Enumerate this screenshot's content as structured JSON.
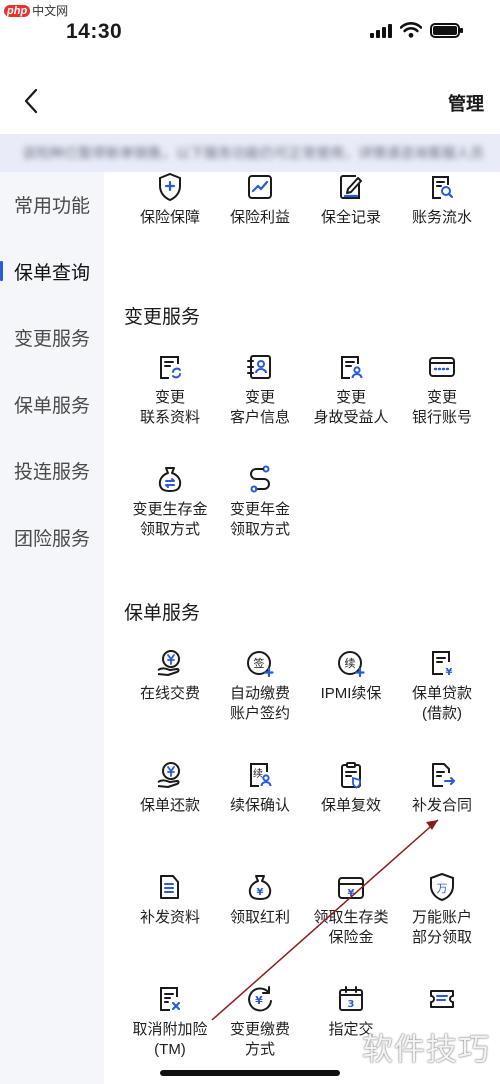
{
  "watermark_top": {
    "logo": "php",
    "site": "中文网"
  },
  "status": {
    "time": "14:30"
  },
  "nav": {
    "back_icon": "chevron-left-icon",
    "manage_label": "管理"
  },
  "notice": {
    "text": "该险种已暂停新单销售，以下服务功能仍可正常使用，详情请咨询客服人员"
  },
  "sidebar": {
    "items": [
      {
        "label": "常用功能",
        "active": false
      },
      {
        "label": "保单查询",
        "active": true
      },
      {
        "label": "变更服务",
        "active": false
      },
      {
        "label": "保单服务",
        "active": false
      },
      {
        "label": "投连服务",
        "active": false
      },
      {
        "label": "团险服务",
        "active": false
      }
    ]
  },
  "accent_color": "#2a5ad7",
  "query": {
    "items": [
      {
        "label": "保险保障",
        "icon": "shield-plus-icon"
      },
      {
        "label": "保险利益",
        "icon": "trend-chart-icon"
      },
      {
        "label": "保全记录",
        "icon": "document-edit-icon"
      },
      {
        "label": "账务流水",
        "icon": "document-search-icon"
      }
    ]
  },
  "change": {
    "title": "变更服务",
    "items": [
      {
        "label": "变更\n联系资料",
        "icon": "contact-refresh-icon"
      },
      {
        "label": "变更\n客户信息",
        "icon": "customer-card-icon"
      },
      {
        "label": "变更\n身故受益人",
        "icon": "beneficiary-doc-icon"
      },
      {
        "label": "变更\n银行账号",
        "icon": "bank-card-icon"
      },
      {
        "label": "变更生存金\n领取方式",
        "icon": "money-bag-exchange-icon"
      },
      {
        "label": "变更年金\n领取方式",
        "icon": "route-s-icon"
      }
    ]
  },
  "policy": {
    "title": "保单服务",
    "items": [
      {
        "label": "在线交费",
        "icon": "hand-coin-icon"
      },
      {
        "label": "自动缴费\n账户签约",
        "icon": "sign-circle-icon"
      },
      {
        "label": "IPMI续保",
        "icon": "renew-circle-icon"
      },
      {
        "label": "保单贷款\n(借款)",
        "icon": "loan-doc-icon"
      },
      {
        "label": "保单还款",
        "icon": "hand-coin-repay-icon"
      },
      {
        "label": "续保确认",
        "icon": "renew-confirm-icon"
      },
      {
        "label": "保单复效",
        "icon": "policy-reinstate-icon"
      },
      {
        "label": "补发合同",
        "icon": "contract-reissue-icon"
      },
      {
        "label": "补发资料",
        "icon": "document-lines-icon"
      },
      {
        "label": "领取红利",
        "icon": "money-bag-icon"
      },
      {
        "label": "领取生存类\n保险金",
        "icon": "wallet-yuan-icon"
      },
      {
        "label": "万能账户\n部分领取",
        "icon": "universal-shield-icon"
      },
      {
        "label": "取消附加险\n(TM)",
        "icon": "document-cancel-icon"
      },
      {
        "label": "变更缴费\n方式",
        "icon": "yuan-exchange-icon"
      },
      {
        "label": "指定交",
        "icon": "calendar-3-icon"
      },
      {
        "label": "",
        "icon": "ticket-list-icon"
      }
    ]
  },
  "watermark_bottom": {
    "text": "软件技巧"
  }
}
